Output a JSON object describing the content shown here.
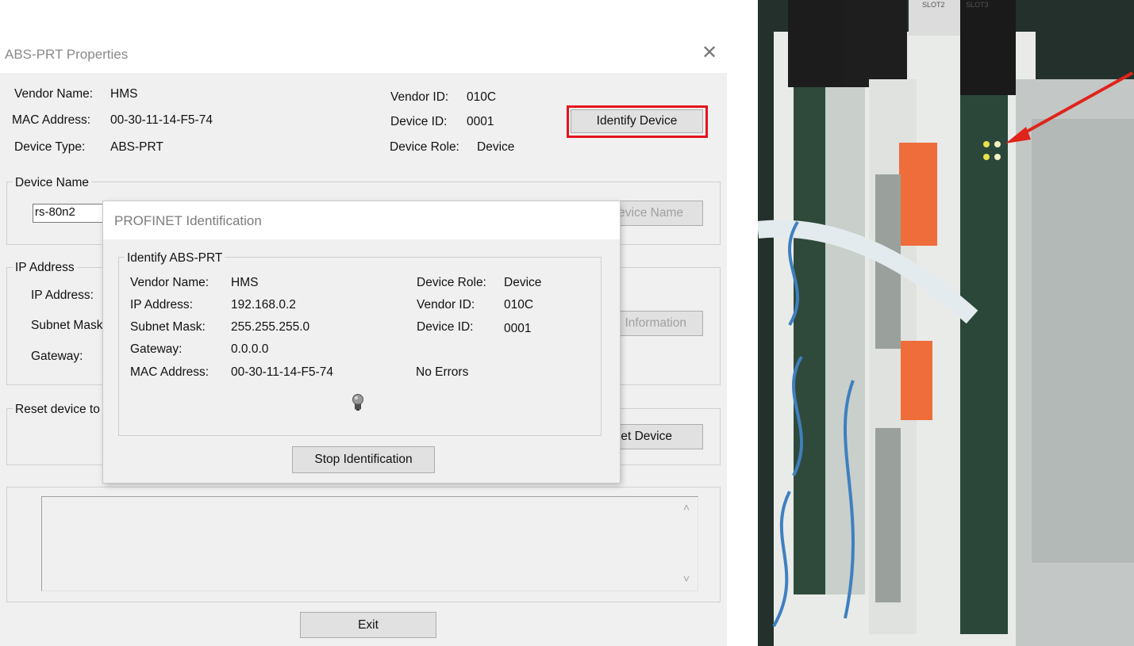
{
  "window": {
    "title": "ABS-PRT Properties",
    "close_glyph": "✕"
  },
  "device_info": {
    "vendor_name_label": "Vendor Name:",
    "vendor_name": "HMS",
    "mac_label": "MAC Address:",
    "mac": "00-30-11-14-F5-74",
    "device_type_label": "Device Type:",
    "device_type": "ABS-PRT",
    "vendor_id_label": "Vendor ID:",
    "vendor_id": "010C",
    "device_id_label": "Device ID:",
    "device_id": "0001",
    "device_role_label": "Device Role:",
    "device_role": "Device",
    "identify_button": "Identify Device",
    "highlight_color": "#e4141c"
  },
  "device_name_group": {
    "legend": "Device Name",
    "value": "rs-80n2",
    "set_button": "evice Name"
  },
  "ip_group": {
    "legend": "IP Address",
    "ip_label": "IP Address:",
    "subnet_label": "Subnet Mask",
    "gateway_label": "Gateway:",
    "info_button": "Information"
  },
  "reset_group": {
    "legend": "Reset device to",
    "reset_button": "et Device"
  },
  "log": {
    "scroll_up": "˄",
    "scroll_down": "˅"
  },
  "exit_button": "Exit",
  "modal": {
    "title": "PROFINET Identification",
    "group_legend": "Identify ABS-PRT",
    "vendor_name_label": "Vendor Name:",
    "vendor_name": "HMS",
    "ip_label": "IP Address:",
    "ip": "192.168.0.2",
    "subnet_label": "Subnet Mask:",
    "subnet": "255.255.255.0",
    "gateway_label": "Gateway:",
    "gateway": "0.0.0.0",
    "mac_label": "MAC Address:",
    "mac": "00-30-11-14-F5-74",
    "device_role_label": "Device Role:",
    "device_role": "Device",
    "vendor_id_label": "Vendor ID:",
    "vendor_id": "010C",
    "device_id_label": "Device ID:",
    "device_id": "0001",
    "status": "No Errors",
    "bulb_icon": "lightbulb-icon",
    "stop_button": "Stop Identification"
  },
  "photo": {
    "slot_labels": [
      "SLOT2",
      "SLOT3"
    ],
    "arrow_color": "#e0241c"
  }
}
